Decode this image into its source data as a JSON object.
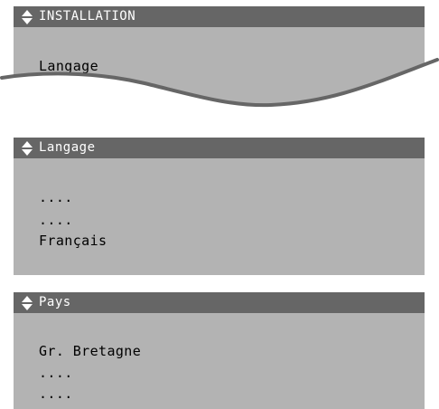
{
  "icons": {
    "menu_marker": "up-down-triangle-icon"
  },
  "colors": {
    "screen_bg": "#b3b3b3",
    "title_bar_bg": "#666666",
    "title_text": "#ffffff",
    "body_text": "#000000"
  },
  "screen_installation": {
    "title": "INSTALLATION",
    "items": [
      "Langage"
    ]
  },
  "screen_langage": {
    "title": "Langage",
    "items": [
      "....",
      "....",
      "Français"
    ]
  },
  "screen_pays": {
    "title": "Pays",
    "items": [
      "Gr. Bretagne",
      "....",
      "...."
    ]
  }
}
